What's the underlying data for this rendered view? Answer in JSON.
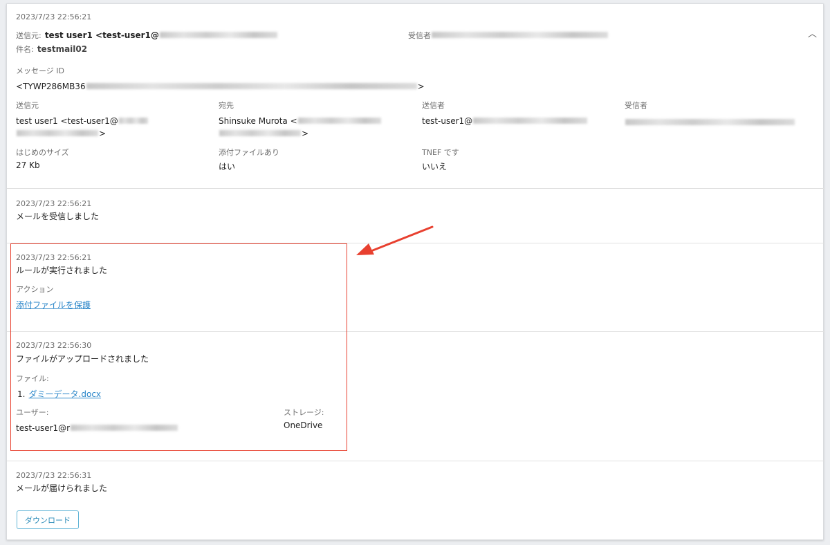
{
  "header": {
    "timestamp": "2023/7/23 22:56:21",
    "from_label": "送信元:",
    "from_value": "test user1 <test-user1@",
    "subject_label": "件名:",
    "subject_value": "testmail02",
    "to_label": "受信者",
    "collapse_icon": "chevron-up-icon"
  },
  "details": {
    "message_id_label": "メッセージ ID",
    "message_id_value": "<TYWP286MB36",
    "message_id_end": ">",
    "sender_label": "送信元",
    "sender_value_line1": "test user1 <test-user1@",
    "sender_value_line2_end": ">",
    "to_label": "宛先",
    "to_value": "Shinsuke Murota <",
    "to_value_end": ">",
    "sender2_label": "送信者",
    "sender2_value": "test-user1@",
    "recipient_label": "受信者",
    "initial_size_label": "はじめのサイズ",
    "initial_size_value": "27 Kb",
    "attachment_label": "添付ファイルあり",
    "attachment_value": "はい",
    "tnef_label": "TNEF です",
    "tnef_value": "いいえ"
  },
  "events": [
    {
      "time": "2023/7/23 22:56:21",
      "text": "メールを受信しました"
    },
    {
      "time": "2023/7/23 22:56:21",
      "text": "ルールが実行されました",
      "action_label": "アクション",
      "action_link": "添付ファイルを保護"
    },
    {
      "time": "2023/7/23 22:56:30",
      "text": "ファイルがアップロードされました",
      "files_label": "ファイル:",
      "file_index": "1.",
      "file_name": "ダミーデータ.docx",
      "user_label": "ユーザー:",
      "user_value": "test-user1@r",
      "storage_label": "ストレージ:",
      "storage_value": "OneDrive"
    },
    {
      "time": "2023/7/23 22:56:31",
      "text": "メールが届けられました"
    }
  ],
  "download_button": "ダウンロード",
  "colors": {
    "highlight": "#e8402f",
    "link": "#2a86c9",
    "button_border": "#62b5d6"
  }
}
